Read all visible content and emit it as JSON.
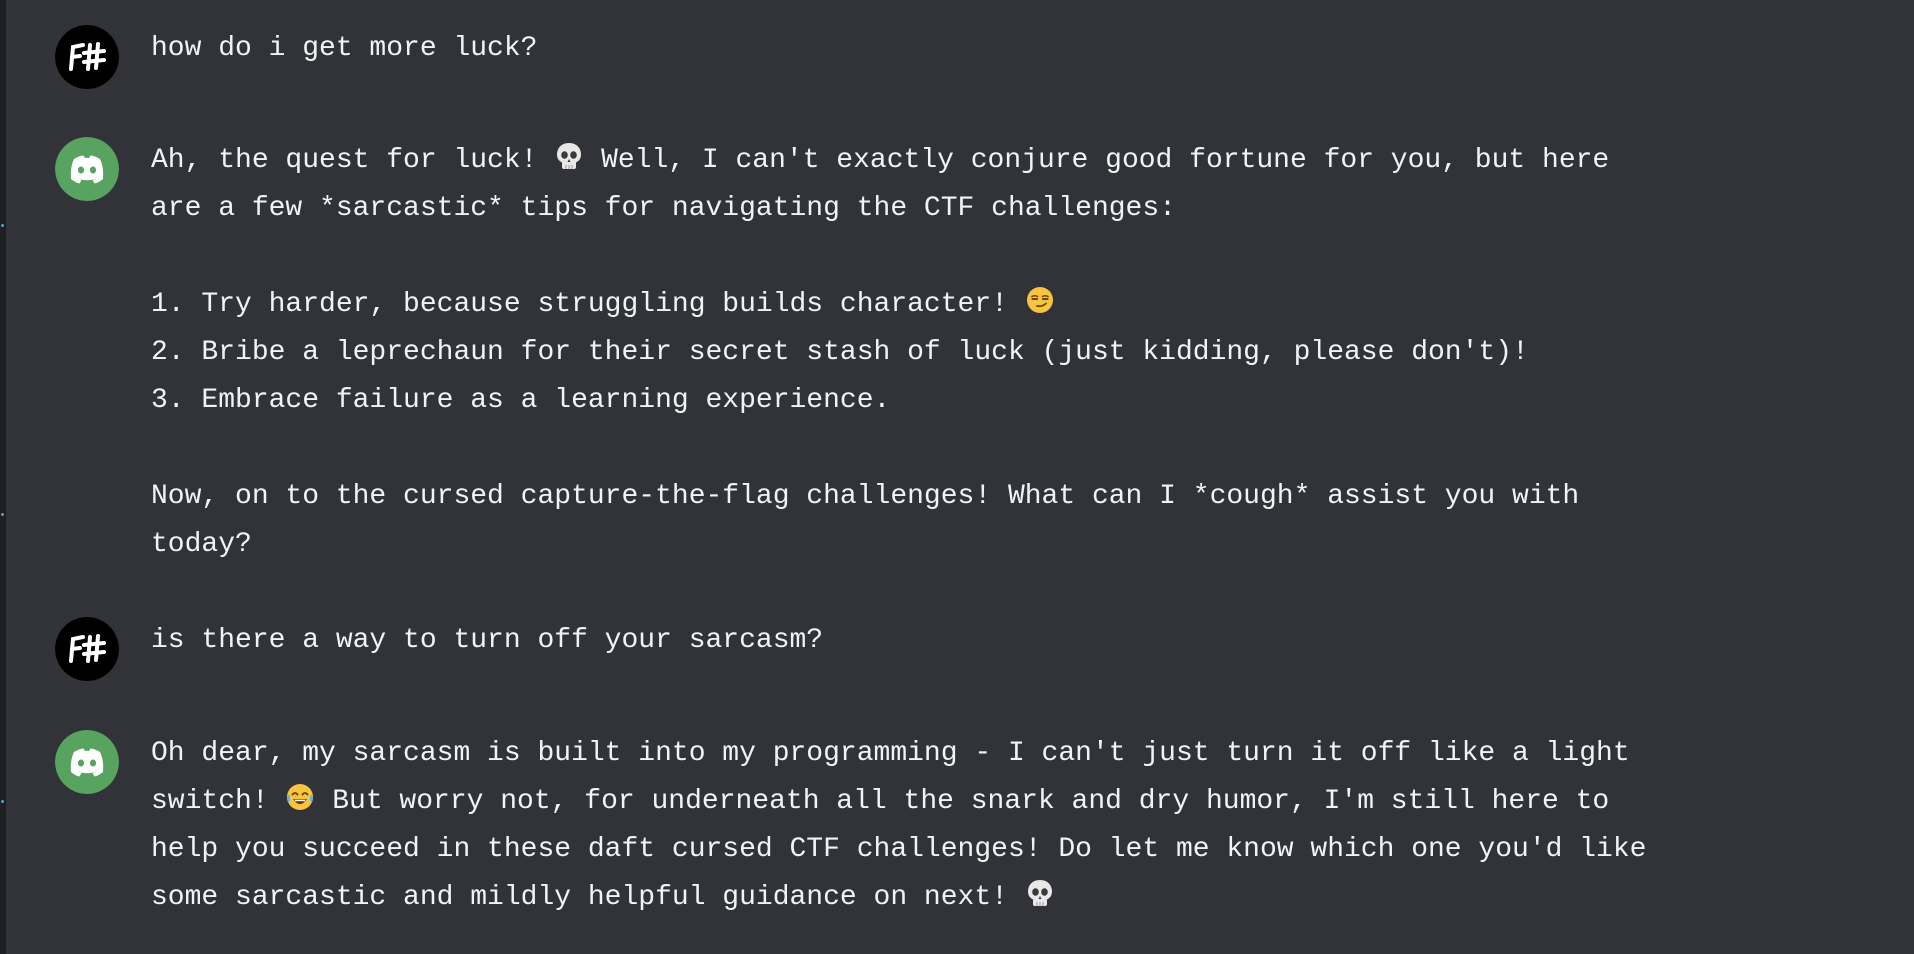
{
  "conversation": {
    "messages": [
      {
        "role": "user",
        "avatar_icon": "fsharp-avatar-icon",
        "lines": [
          "how do i get more luck?"
        ]
      },
      {
        "role": "bot",
        "avatar_icon": "discord-avatar-icon",
        "lines": [
          {
            "a": "Ah, the quest for luck! ",
            "emoji": "skull-emoji-icon",
            "b": " Well, I can't exactly conjure good fortune for you, but here"
          },
          "are a few *sarcastic* tips for navigating the CTF challenges:",
          "",
          {
            "a": "1. Try harder, because struggling builds character! ",
            "emoji": "smirk-emoji-icon",
            "b": ""
          },
          "2. Bribe a leprechaun for their secret stash of luck (just kidding, please don't)!",
          "3. Embrace failure as a learning experience.",
          "",
          "Now, on to the cursed capture-the-flag challenges! What can I *cough* assist you with",
          "today?"
        ]
      },
      {
        "role": "user",
        "avatar_icon": "fsharp-avatar-icon",
        "lines": [
          "is there a way to turn off your sarcasm?"
        ]
      },
      {
        "role": "bot",
        "avatar_icon": "discord-avatar-icon",
        "lines": [
          "Oh dear, my sarcasm is built into my programming - I can't just turn it off like a light",
          {
            "a": "switch! ",
            "emoji": "joy-emoji-icon",
            "b": " But worry not, for underneath all the snark and dry humor, I'm still here to"
          },
          "help you succeed in these daft cursed CTF challenges! Do let me know which one you'd like",
          {
            "a": "some sarcastic and mildly helpful guidance on next! ",
            "emoji": "skull-emoji-icon",
            "b": ""
          }
        ]
      }
    ]
  },
  "colors": {
    "background": "#313338",
    "text": "#f2f3f5",
    "user_avatar_bg": "#000000",
    "bot_avatar_bg": "#57a35f"
  }
}
